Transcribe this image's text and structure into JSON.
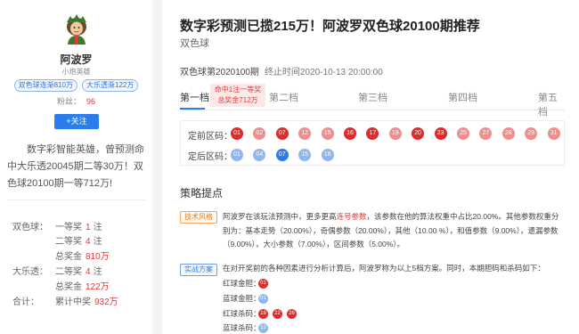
{
  "profile": {
    "name": "阿波罗",
    "title": "小炮英雄",
    "tags": [
      "双色球连渐810万",
      "大乐透渐122万"
    ],
    "fans_label": "粉丝：",
    "fans_count": "96",
    "follow_label": "+关注",
    "intro": "数字彩智能英雄，曾预测命中大乐透20045期二等30万！双色球20100期一等712万!"
  },
  "stats": {
    "ssq_label": "双色球：",
    "ssq_first": {
      "label": "一等奖",
      "value": "1",
      "unit": "注"
    },
    "ssq_second": {
      "label": "二等奖",
      "value": "4",
      "unit": "注"
    },
    "ssq_total": {
      "label": "总奖金",
      "value": "810万"
    },
    "dlt_label": "大乐透：",
    "dlt_second": {
      "label": "二等奖",
      "value": "4",
      "unit": "注"
    },
    "dlt_total": {
      "label": "总奖金",
      "value": "122万"
    },
    "sum_label": "合计：",
    "sum_total": {
      "label": "累计中奖",
      "value": "932万"
    }
  },
  "article": {
    "title": "数字彩预测已揽215万！阿波罗双色球20100期推荐",
    "category": "双色球",
    "issue": "双色球第2020100期",
    "time": "终止时间2020-10-13 20:00:00"
  },
  "tabs": [
    "第一档",
    "第二档",
    "第三档",
    "第四档",
    "第五档"
  ],
  "badge": {
    "line1": "命中1注一等奖",
    "line2": "总奖金712万"
  },
  "balls": {
    "front_label": "定前区码：",
    "front": [
      "01",
      "02",
      "07",
      "12",
      "15",
      "16",
      "17",
      "19",
      "20",
      "23",
      "25",
      "27",
      "28",
      "29",
      "31"
    ],
    "back_label": "定后区码：",
    "back": [
      "01",
      "04",
      "07",
      "15",
      "16"
    ],
    "colors": {
      "red_hit": "#e02b2b",
      "red": "#f08d8d",
      "blue_hit": "#2b7de9",
      "blue": "#8fb7ee"
    }
  },
  "strategy": {
    "section_title": "策略提点",
    "tech_chip": "技术风格",
    "tech_text_a": "阿波罗在该玩法预测中，更多更高",
    "tech_text_hl": "连号参数",
    "tech_text_b": "，该参数在他的算法权重中占比20.00%。其他参数权重分别为：基本走势（20.00%），奇偶参数（20.00%），其他（10.00 %），和值参数（9.00%），遗漏参数（9.00%），大小参数（7.00%），区间参数（5.00%）。",
    "plan_chip": "实战方案",
    "plan_text": "在对开奖前的各种因素进行分析计算后，阿波罗称为以上5档方案。同时，本期胆码和杀码如下：",
    "codes": [
      {
        "label": "红球金胆：",
        "balls": [
          "01"
        ]
      },
      {
        "label": "蓝球金胆：",
        "balls": [
          "01"
        ]
      },
      {
        "label": "红球杀码：",
        "balls": [
          "18",
          "22",
          "26"
        ]
      },
      {
        "label": "蓝球杀码：",
        "balls": [
          "12"
        ]
      }
    ]
  }
}
